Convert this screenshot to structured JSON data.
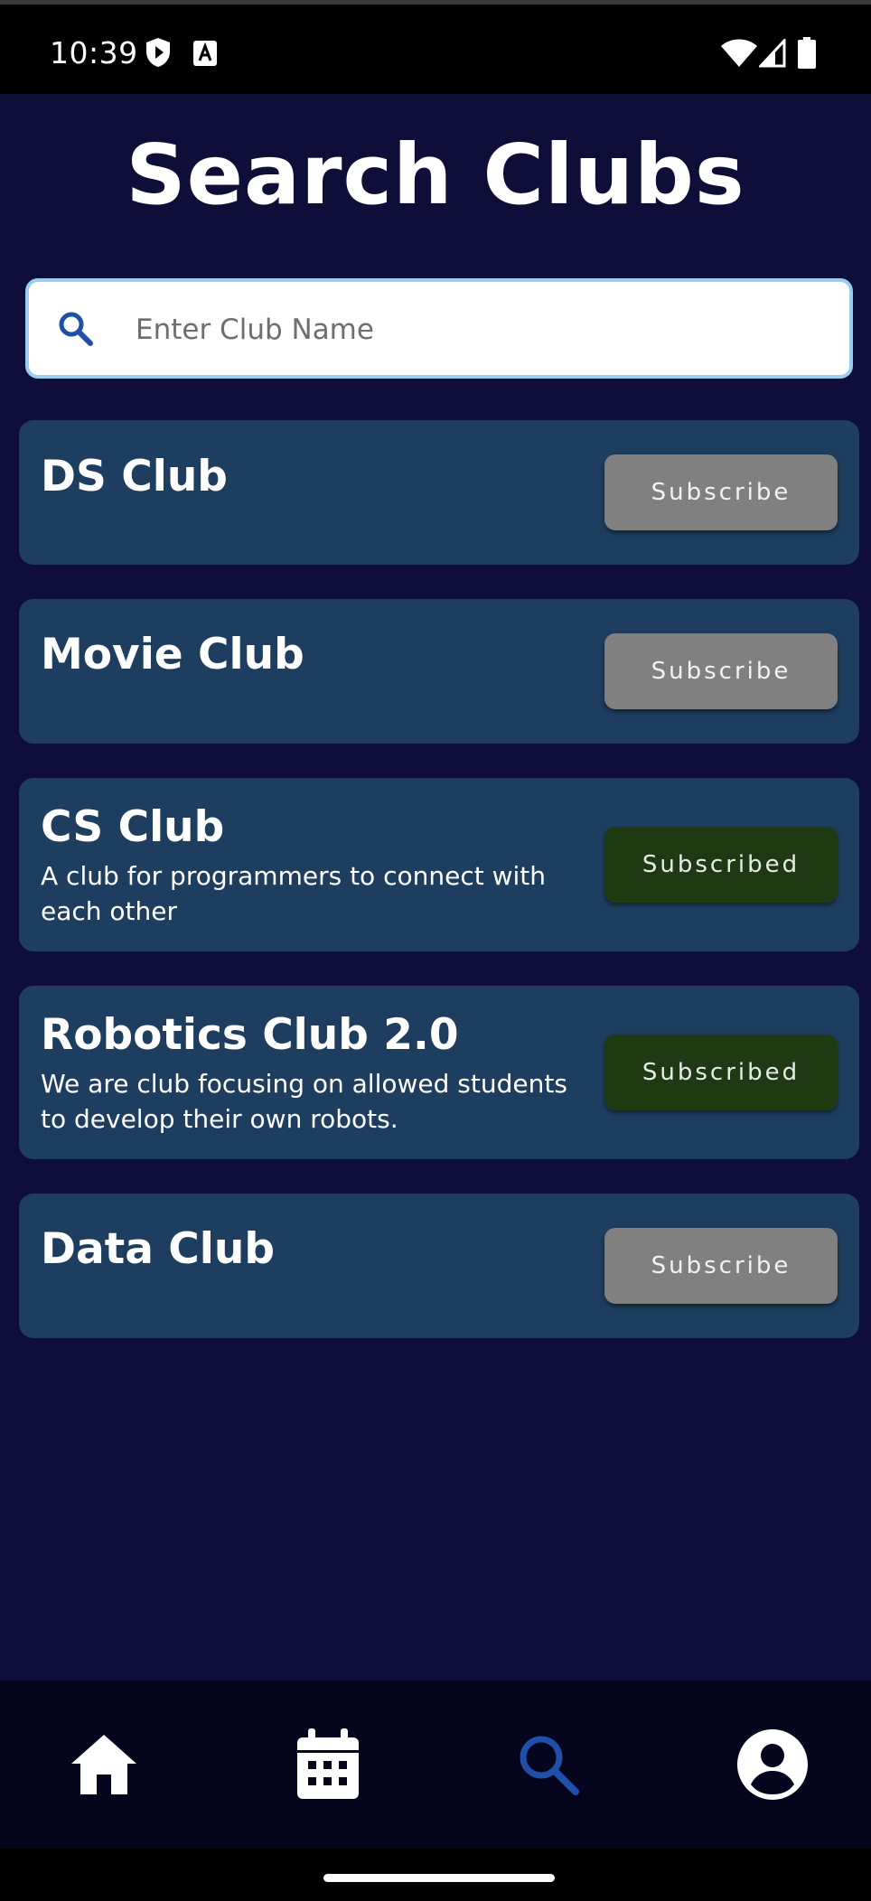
{
  "status_bar": {
    "time": "10:39",
    "left_icons": [
      "shield-play-icon",
      "font-a-icon"
    ],
    "right_icons": [
      "wifi-icon",
      "signal-icon",
      "battery-icon"
    ]
  },
  "page": {
    "title": "Search Clubs"
  },
  "search": {
    "placeholder": "Enter Club Name",
    "value": "",
    "icon": "search-icon"
  },
  "clubs": [
    {
      "name": "DS Club",
      "description": "",
      "button_label": "Subscribe",
      "subscribed": false
    },
    {
      "name": "Movie Club",
      "description": "",
      "button_label": "Subscribe",
      "subscribed": false
    },
    {
      "name": "CS Club",
      "description": "A club for programmers to connect with each other",
      "button_label": "Subscribed",
      "subscribed": true
    },
    {
      "name": "Robotics Club 2.0",
      "description": "We are club focusing on allowed students to develop their own robots.",
      "button_label": "Subscribed",
      "subscribed": true
    },
    {
      "name": "Data Club",
      "description": "",
      "button_label": "Subscribe",
      "subscribed": false
    }
  ],
  "bottom_nav": {
    "items": [
      {
        "icon": "home-icon",
        "active": false
      },
      {
        "icon": "calendar-icon",
        "active": false
      },
      {
        "icon": "search-icon",
        "active": true
      },
      {
        "icon": "account-icon",
        "active": false
      }
    ]
  },
  "colors": {
    "background": "#0e0e38",
    "card": "#1d3e5e",
    "subscribe_button": "#808080",
    "subscribed_button": "#1e3a12",
    "nav_background": "#05051d",
    "nav_active": "#1f4fa8",
    "nav_inactive": "#ffffff",
    "search_border": "#9ccdf0"
  }
}
